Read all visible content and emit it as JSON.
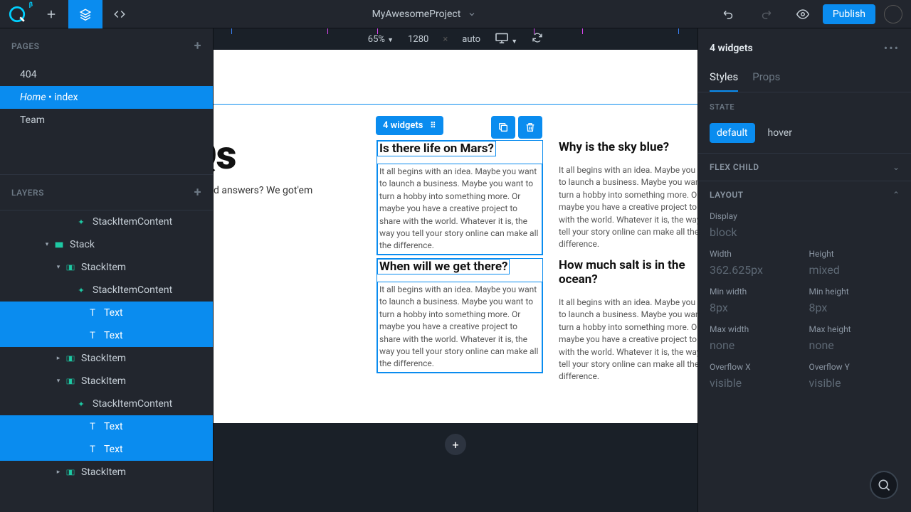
{
  "topbar": {
    "project": "MyAwesomeProject",
    "publish": "Publish"
  },
  "pages": {
    "heading": "PAGES",
    "items": [
      "404",
      "Home • index",
      "Team"
    ]
  },
  "layers": {
    "heading": "LAYERS",
    "rows": [
      {
        "name": "StackItemContent",
        "depth": 3
      },
      {
        "name": "Stack",
        "depth": 1
      },
      {
        "name": "StackItem",
        "depth": 2
      },
      {
        "name": "StackItemContent",
        "depth": 3
      },
      {
        "name": "Text",
        "depth": 4,
        "sel": true
      },
      {
        "name": "Text",
        "depth": 4,
        "sel": true
      },
      {
        "name": "StackItem",
        "depth": 2
      },
      {
        "name": "StackItem",
        "depth": 2
      },
      {
        "name": "StackItemContent",
        "depth": 3
      },
      {
        "name": "Text",
        "depth": 4,
        "sel": true
      },
      {
        "name": "Text",
        "depth": 4,
        "sel": true
      },
      {
        "name": "StackItem",
        "depth": 2
      }
    ]
  },
  "canvas": {
    "zoom": "65%",
    "width": "1280",
    "height_sep": "×",
    "height": "auto",
    "chip_label": "4 widgets",
    "faq_title": "FAQs",
    "faq_sub": "d answers? We got'em",
    "body_text": "It all begins with an idea. Maybe you want to launch a business. Maybe you want to turn a hobby into something more. Or maybe you have a creative project to share with the world. Whatever it is, the way you tell your story online can make all the difference.",
    "q1": "Is there life on Mars?",
    "q2": "Why is the sky blue?",
    "q3": "When will we get there?",
    "q4": "How much salt is in the ocean?"
  },
  "inspector": {
    "title": "4 widgets",
    "tabs": {
      "styles": "Styles",
      "props": "Props"
    },
    "state_label": "STATE",
    "states": {
      "default": "default",
      "hover": "hover"
    },
    "sections": {
      "flex": "FLEX CHILD",
      "layout": "LAYOUT"
    },
    "layout": {
      "display_lbl": "Display",
      "display_val": "block",
      "width_lbl": "Width",
      "width_val": "362.625px",
      "height_lbl": "Height",
      "height_val": "mixed",
      "minw_lbl": "Min width",
      "minw_val": "8px",
      "minh_lbl": "Min height",
      "minh_val": "8px",
      "maxw_lbl": "Max width",
      "maxw_val": "none",
      "maxh_lbl": "Max height",
      "maxh_val": "none",
      "ofx_lbl": "Overflow X",
      "ofx_val": "visible",
      "ofy_lbl": "Overflow Y",
      "ofy_val": "visible"
    }
  }
}
